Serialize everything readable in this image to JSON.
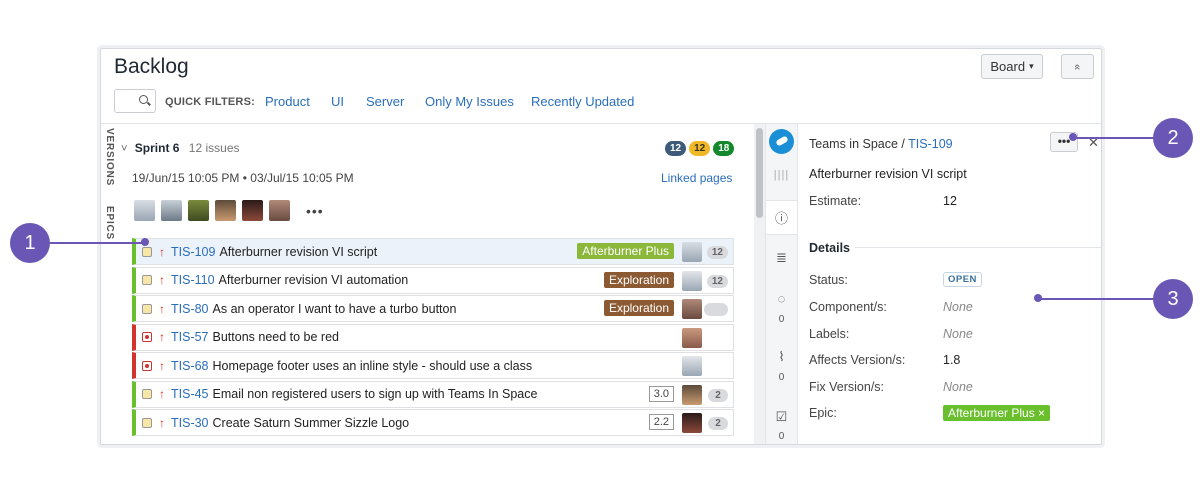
{
  "header": {
    "title": "Backlog",
    "board_label": "Board",
    "collapse_label": "«"
  },
  "filters": {
    "label": "QUICK FILTERS:",
    "items": [
      "Product",
      "UI",
      "Server",
      "Only My Issues",
      "Recently Updated"
    ]
  },
  "side_tabs": [
    "VERSIONS",
    "EPICS"
  ],
  "sprint": {
    "name": "Sprint 6",
    "issue_count": "12 issues",
    "status_counts": [
      {
        "value": "12",
        "color": "#3d5a78"
      },
      {
        "value": "12",
        "color": "#f1b825"
      },
      {
        "value": "18",
        "color": "#14892c"
      }
    ],
    "dates": "19/Jun/15 10:05 PM • 03/Jul/15 10:05 PM",
    "linked_pages": "Linked pages",
    "more": "•••"
  },
  "issues": [
    {
      "type": "story",
      "key": "TIS-109",
      "summary": "Afterburner revision VI script",
      "epic": "Afterburner Plus",
      "epic_color": "#8bb83a",
      "estimate": "",
      "points": "12",
      "selected": true,
      "bar_color": "#6abf2c"
    },
    {
      "type": "story",
      "key": "TIS-110",
      "summary": "Afterburner revision VI automation",
      "epic": "Exploration",
      "epic_color": "#8c5a32",
      "estimate": "",
      "points": "12",
      "selected": false,
      "bar_color": "#6abf2c"
    },
    {
      "type": "story",
      "key": "TIS-80",
      "summary": "As an operator I want to have a turbo button",
      "epic": "Exploration",
      "epic_color": "#8c5a32",
      "estimate": "",
      "points": "",
      "selected": false,
      "bar_color": "#6abf2c"
    },
    {
      "type": "bug",
      "key": "TIS-57",
      "summary": "Buttons need to be red",
      "epic": "",
      "epic_color": "",
      "estimate": "",
      "points": null,
      "selected": false,
      "bar_color": "#d0342c"
    },
    {
      "type": "bug",
      "key": "TIS-68",
      "summary": "Homepage footer uses an inline style - should use a class",
      "epic": "",
      "epic_color": "",
      "estimate": "",
      "points": null,
      "selected": false,
      "bar_color": "#d0342c"
    },
    {
      "type": "story",
      "key": "TIS-45",
      "summary": "Email non registered users to sign up with Teams In Space",
      "epic": "",
      "epic_color": "",
      "estimate": "3.0",
      "points": "2",
      "selected": false,
      "bar_color": "#6abf2c"
    },
    {
      "type": "story",
      "key": "TIS-30",
      "summary": "Create Saturn Summer Sizzle Logo",
      "epic": "",
      "epic_color": "",
      "estimate": "2.2",
      "points": "2",
      "selected": false,
      "bar_color": "#6abf2c"
    }
  ],
  "detail": {
    "project": "Teams in Space",
    "separator": "/",
    "key": "TIS-109",
    "more": "•••",
    "summary": "Afterburner revision VI script",
    "estimate_label": "Estimate:",
    "estimate_value": "12",
    "section_title": "Details",
    "status_label": "Status:",
    "status_value": "OPEN",
    "components_label": "Component/s:",
    "components_value": "None",
    "labels_label": "Labels:",
    "labels_value": "None",
    "affects_label": "Affects Version/s:",
    "affects_value": "1.8",
    "fix_label": "Fix Version/s:",
    "fix_value": "None",
    "epic_label": "Epic:",
    "epic_value": "Afterburner Plus ×",
    "comments_count": "0",
    "attachments_count": "0",
    "subtasks_count": "0"
  },
  "callouts": [
    "1",
    "2",
    "3"
  ],
  "colors": {
    "accent_link": "#2a6ebb",
    "callout": "#6a56b4",
    "story_bar": "#6abf2c",
    "bug_bar": "#d0342c"
  }
}
